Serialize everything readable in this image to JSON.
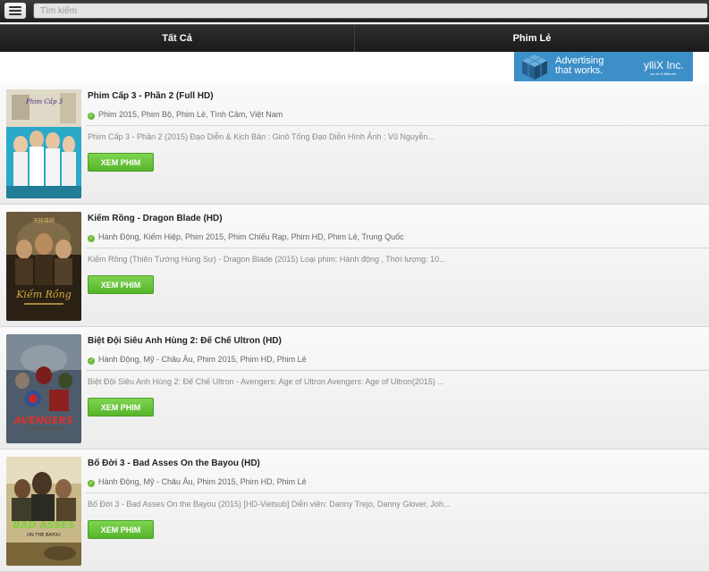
{
  "search": {
    "placeholder": "Tìm kiếm"
  },
  "tabs": [
    {
      "label": "Tất Cả"
    },
    {
      "label": "Phim Lẻ"
    }
  ],
  "ad": {
    "line1": "Advertising",
    "line2": "that works.",
    "brand": "ylliX Inc.",
    "tagline": "we do it different"
  },
  "movies": [
    {
      "title": "Phim Cấp 3 - Phần 2 (Full HD)",
      "categories": "Phim 2015, Phim Bộ, Phim Lẻ, Tình Cảm, Việt Nam",
      "description": "Phim Cấp 3 - Phần 2 (2015) Đạo Diễn & Kịch Bản : Ginô Tống Đạo Diễn Hình Ảnh : Vũ Nguyễn...",
      "button": "XEM PHIM",
      "poster_text": "Phim Cấp 3"
    },
    {
      "title": "Kiếm Rồng - Dragon Blade (HD)",
      "categories": "Hành Động, Kiếm Hiệp, Phim 2015, Phim Chiếu Rạp, Phim HD, Phim Lẻ, Trung Quốc",
      "description": "Kiếm Rồng (Thiên Tướng Hùng Sư) - Dragon Blade (2015) Loại phim: Hành động , Thời lượng: 10...",
      "button": "XEM PHIM",
      "poster_text": "Kiếm Rồng"
    },
    {
      "title": "Biệt Đội Siêu Anh Hùng 2: Đế Chế Ultron (HD)",
      "categories": "Hành Động, Mỹ - Châu Âu, Phim 2015, Phim HD, Phim Lẻ",
      "description": "Biệt Đội Siêu Anh Hùng 2: Đế Chế Ultron - Avengers: Age of Ultron Avengers: Age of Ultron(2015) ...",
      "button": "XEM PHIM",
      "poster_text": "AVENGERS"
    },
    {
      "title": "Bố Đời 3 - Bad Asses On the Bayou (HD)",
      "categories": "Hành Động, Mỹ - Châu Âu, Phim 2015, Phim HD, Phim Lẻ",
      "description": "Bố Đời 3 - Bad Asses On the Bayou (2015) [HD-Vietsub] Diễn viên: Danny Trejo, Danny Glover, Joh...",
      "button": "XEM PHIM",
      "poster_text": "BAD ASSES"
    }
  ]
}
